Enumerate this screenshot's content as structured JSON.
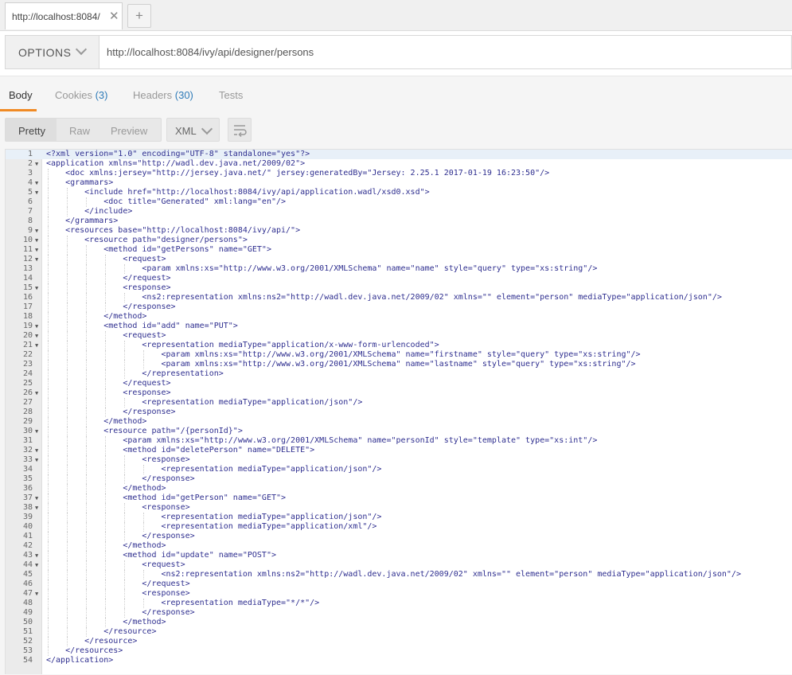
{
  "tab": {
    "title": "http://localhost:8084/",
    "close": "✕",
    "new": "+"
  },
  "request": {
    "method": "OPTIONS",
    "url": "http://localhost:8084/ivy/api/designer/persons"
  },
  "response_tabs": [
    {
      "label": "Body",
      "count": ""
    },
    {
      "label": "Cookies",
      "count": "(3)"
    },
    {
      "label": "Headers",
      "count": "(30)"
    },
    {
      "label": "Tests",
      "count": ""
    }
  ],
  "view": {
    "pretty": "Pretty",
    "raw": "Raw",
    "preview": "Preview",
    "format": "XML"
  },
  "code_lines": [
    "<?xml version=\"1.0\" encoding=\"UTF-8\" standalone=\"yes\"?>",
    "<application xmlns=\"http://wadl.dev.java.net/2009/02\">",
    "    <doc xmlns:jersey=\"http://jersey.java.net/\" jersey:generatedBy=\"Jersey: 2.25.1 2017-01-19 16:23:50\"/>",
    "    <grammars>",
    "        <include href=\"http://localhost:8084/ivy/api/application.wadl/xsd0.xsd\">",
    "            <doc title=\"Generated\" xml:lang=\"en\"/>",
    "        </include>",
    "    </grammars>",
    "    <resources base=\"http://localhost:8084/ivy/api/\">",
    "        <resource path=\"designer/persons\">",
    "            <method id=\"getPersons\" name=\"GET\">",
    "                <request>",
    "                    <param xmlns:xs=\"http://www.w3.org/2001/XMLSchema\" name=\"name\" style=\"query\" type=\"xs:string\"/>",
    "                </request>",
    "                <response>",
    "                    <ns2:representation xmlns:ns2=\"http://wadl.dev.java.net/2009/02\" xmlns=\"\" element=\"person\" mediaType=\"application/json\"/>",
    "                </response>",
    "            </method>",
    "            <method id=\"add\" name=\"PUT\">",
    "                <request>",
    "                    <representation mediaType=\"application/x-www-form-urlencoded\">",
    "                        <param xmlns:xs=\"http://www.w3.org/2001/XMLSchema\" name=\"firstname\" style=\"query\" type=\"xs:string\"/>",
    "                        <param xmlns:xs=\"http://www.w3.org/2001/XMLSchema\" name=\"lastname\" style=\"query\" type=\"xs:string\"/>",
    "                    </representation>",
    "                </request>",
    "                <response>",
    "                    <representation mediaType=\"application/json\"/>",
    "                </response>",
    "            </method>",
    "            <resource path=\"/{personId}\">",
    "                <param xmlns:xs=\"http://www.w3.org/2001/XMLSchema\" name=\"personId\" style=\"template\" type=\"xs:int\"/>",
    "                <method id=\"deletePerson\" name=\"DELETE\">",
    "                    <response>",
    "                        <representation mediaType=\"application/json\"/>",
    "                    </response>",
    "                </method>",
    "                <method id=\"getPerson\" name=\"GET\">",
    "                    <response>",
    "                        <representation mediaType=\"application/json\"/>",
    "                        <representation mediaType=\"application/xml\"/>",
    "                    </response>",
    "                </method>",
    "                <method id=\"update\" name=\"POST\">",
    "                    <request>",
    "                        <ns2:representation xmlns:ns2=\"http://wadl.dev.java.net/2009/02\" xmlns=\"\" element=\"person\" mediaType=\"application/json\"/>",
    "                    </request>",
    "                    <response>",
    "                        <representation mediaType=\"*/*\"/>",
    "                    </response>",
    "                </method>",
    "            </resource>",
    "        </resource>",
    "    </resources>",
    "</application>"
  ],
  "foldable_lines": [
    2,
    4,
    5,
    9,
    10,
    11,
    12,
    15,
    19,
    20,
    21,
    26,
    30,
    32,
    33,
    37,
    38,
    43,
    44,
    47
  ]
}
